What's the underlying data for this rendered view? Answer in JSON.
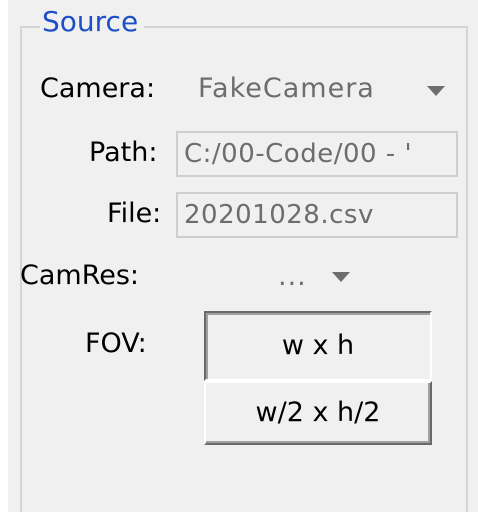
{
  "group": {
    "title": "Source"
  },
  "camera": {
    "label": "Camera:",
    "selected": "FakeCamera"
  },
  "path": {
    "label": "Path:",
    "value": "C:/00-Code/00 - '"
  },
  "file": {
    "label": "File:",
    "value": "20201028.csv"
  },
  "camres": {
    "label": "CamRes:",
    "selected": "..."
  },
  "fov": {
    "label": "FOV:",
    "options": [
      "w x h",
      "w/2 x h/2"
    ],
    "active_option": "w x h"
  },
  "icons": {
    "dropdown": "chevron-down-icon"
  },
  "colors": {
    "panel_bg": "#f0f0f0",
    "group_title": "#1f4fc8",
    "disabled_text": "#6d6d6d",
    "border": "#cfcfcf"
  }
}
